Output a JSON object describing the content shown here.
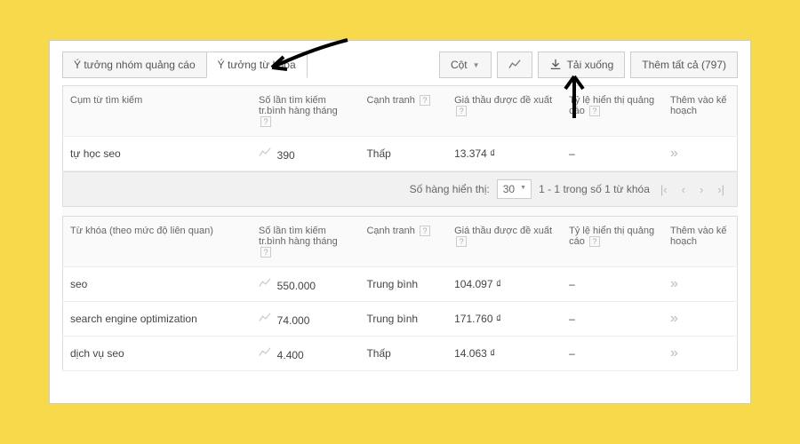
{
  "toolbar": {
    "tab1": "Ý tưởng nhóm quảng cáo",
    "tab2": "Ý tưởng từ khóa",
    "cols": "Cột",
    "download": "Tải xuống",
    "add_all": "Thêm tất cả (797)"
  },
  "columns": {
    "term": "Cụm từ tìm kiếm",
    "avg": "Số lần tìm kiếm\ntr.bình hàng tháng",
    "comp": "Cạnh tranh",
    "bid": "Giá thầu được đề xuất",
    "impr": "Tỷ lệ hiển thị quảng cáo",
    "add": "Thêm vào kế hoạch"
  },
  "columns2": {
    "keyword": "Từ khóa (theo mức độ liên quan)"
  },
  "rows1": [
    {
      "term": "tự học seo",
      "avg": "390",
      "comp": "Thấp",
      "bid": "13.374 ₫",
      "impr": "–"
    }
  ],
  "pager": {
    "label": "Số hàng hiển thị:",
    "size": "30",
    "range": "1 - 1 trong số 1 từ khóa"
  },
  "rows2": [
    {
      "term": "seo",
      "avg": "550.000",
      "comp": "Trung bình",
      "bid": "104.097 ₫",
      "impr": "–"
    },
    {
      "term": "search engine optimization",
      "avg": "74.000",
      "comp": "Trung bình",
      "bid": "171.760 ₫",
      "impr": "–"
    },
    {
      "term": "dịch vụ seo",
      "avg": "4.400",
      "comp": "Thấp",
      "bid": "14.063 ₫",
      "impr": "–"
    }
  ]
}
